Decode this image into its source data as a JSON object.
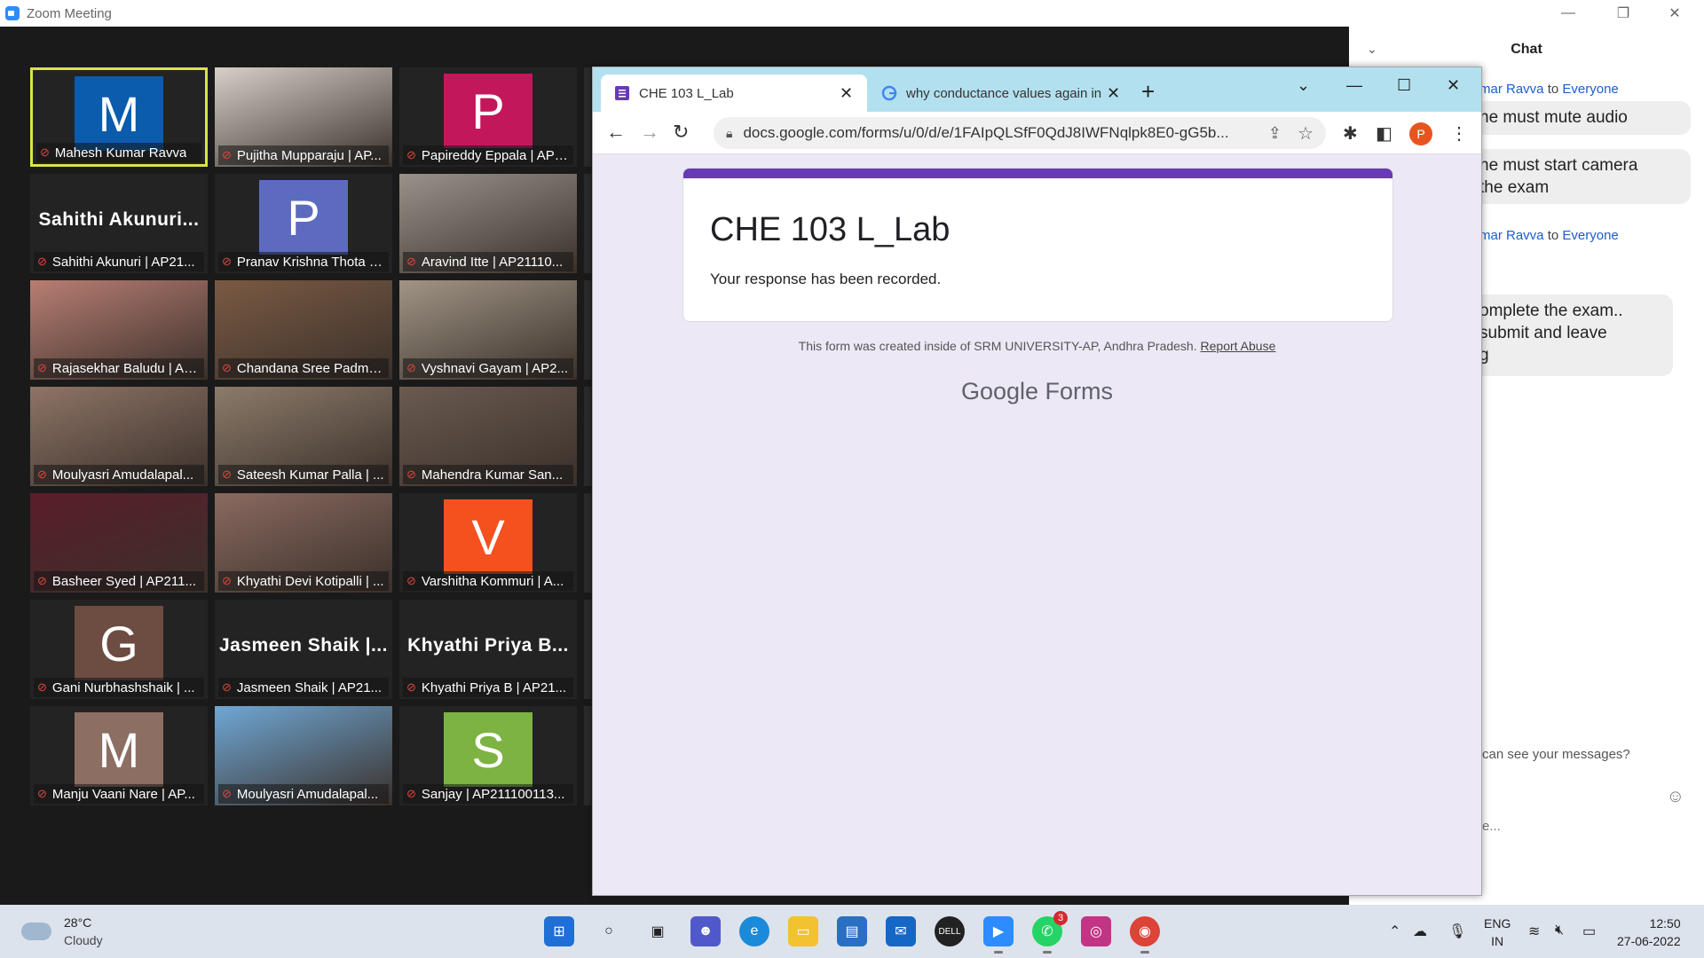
{
  "zoom": {
    "title": "Zoom Meeting",
    "minimize": "—",
    "restore": "❐",
    "close": "✕"
  },
  "participants": [
    {
      "name": "Mahesh Kumar Ravva",
      "avatar_letter": "M",
      "avatar_color": "#0b5cad",
      "active": true
    },
    {
      "name": "Pujitha Mupparaju | AP...",
      "video": true,
      "video_color": "#d6d0c8"
    },
    {
      "name": "Papireddy Eppala | AP2...",
      "avatar_letter": "P",
      "avatar_color": "#c2185b"
    },
    {
      "name": "Sahithi Akunuri | AP21...",
      "big_name": "Sahithi Akunuri..."
    },
    {
      "name": "Pranav Krishna Thota | ...",
      "avatar_letter": "P",
      "avatar_color": "#5c6bc0"
    },
    {
      "name": "Aravind Itte | AP21110...",
      "video": true,
      "video_color": "#9a928a"
    },
    {
      "name": "Rajasekhar Baludu | AP...",
      "video": true,
      "video_color": "#b87e73"
    },
    {
      "name": "Chandana Sree Padma...",
      "video": true,
      "video_color": "#7a5a43"
    },
    {
      "name": "Vyshnavi Gayam | AP2...",
      "video": true,
      "video_color": "#a09585"
    },
    {
      "name": "Moulyasri Amudalapal...",
      "video": true,
      "video_color": "#8e7466"
    },
    {
      "name": "Sateesh Kumar Palla | ...",
      "video": true,
      "video_color": "#8c7b6a"
    },
    {
      "name": "Mahendra Kumar San...",
      "video": true,
      "video_color": "#6a5a50"
    },
    {
      "name": "Basheer Syed | AP211...",
      "video": true,
      "video_color": "#5a1d2a"
    },
    {
      "name": "Khyathi Devi Kotipalli | ...",
      "video": true,
      "video_color": "#8a6a60"
    },
    {
      "name": "Varshitha Kommuri | A...",
      "avatar_letter": "V",
      "avatar_color": "#f4511e"
    },
    {
      "name": "Gani Nurbhashshaik | ...",
      "avatar_letter": "G",
      "avatar_color": "#6d4c41"
    },
    {
      "name": "Jasmeen Shaik | AP21...",
      "big_name": "Jasmeen Shaik |..."
    },
    {
      "name": "Khyathi Priya B | AP21...",
      "big_name": "Khyathi Priya B..."
    },
    {
      "name": "Manju Vaani Nare | AP...",
      "avatar_letter": "M",
      "avatar_color": "#8d6e63"
    },
    {
      "name": "Moulyasri Amudalapal...",
      "video": true,
      "video_color": "#6fa7d4"
    },
    {
      "name": "Sanjay | AP211100113...",
      "avatar_letter": "S",
      "avatar_color": "#7cb342"
    }
  ],
  "chat": {
    "title": "Chat",
    "sender1": "mar Ravva",
    "to1": "to",
    "everyone1": "Everyone",
    "msg1": "ne must mute audio",
    "msg2": "ne must start camera\nthe exam",
    "sender2": "mar Ravva",
    "to2": "to",
    "everyone2": "Everyone",
    "msg3": "omplete the exam..\n submit and leave\ng",
    "hint": "can see your messages?",
    "compose": "e..."
  },
  "browser": {
    "tab1": "CHE 103 L_Lab",
    "tab2": "why conductance values again in",
    "url": "docs.google.com/forms/u/0/d/e/1FAIpQLSfF0QdJ8IWFNqlpk8E0-gG5b...",
    "profile_letter": "P"
  },
  "form": {
    "title": "CHE 103 L_Lab",
    "message": "Your response has been recorded.",
    "footer": "This form was created inside of SRM UNIVERSITY-AP, Andhra Pradesh.",
    "report": "Report Abuse",
    "brand_google": "Google",
    "brand_forms": "Forms",
    "accent_color": "#673ab7"
  },
  "taskbar": {
    "temp": "28°C",
    "condition": "Cloudy",
    "lang1": "ENG",
    "lang2": "IN",
    "time": "12:50",
    "date": "27-06-2022",
    "whatsapp_badge": "3"
  }
}
